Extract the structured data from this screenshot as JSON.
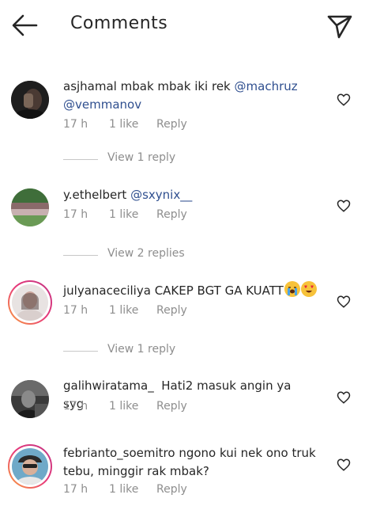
{
  "header": {
    "title": "Comments"
  },
  "comments": [
    {
      "username": "asjhamal",
      "text": "mbak mbak iki rek",
      "mentions": [
        "@machruz",
        "@vemmanov"
      ],
      "time": "17 h",
      "likes": "1 like",
      "reply": "Reply",
      "view_replies": "View 1 reply"
    },
    {
      "username": "y.ethelbert",
      "text": "",
      "mentions": [
        "@sxynix__"
      ],
      "time": "17 h",
      "likes": "1 like",
      "reply": "Reply",
      "view_replies": "View 2 replies"
    },
    {
      "username": "julyanaceciliya",
      "text": "CAKEP BGT GA KUATT",
      "emojis": [
        "loudly-crying-face",
        "heart-eyes-face"
      ],
      "time": "17 h",
      "likes": "1 like",
      "reply": "Reply",
      "view_replies": "View 1 reply"
    },
    {
      "username": "galihwiratama_",
      "text": "Hati2 masuk angin ya syg",
      "time": "17 h",
      "likes": "1 like",
      "reply": "Reply"
    },
    {
      "username": "febrianto_soemitro",
      "text": "ngono kui nek ono truk tebu, minggir rak mbak?",
      "time": "17 h",
      "likes": "1 like",
      "reply": "Reply"
    }
  ],
  "colors": {
    "text": "#262626",
    "muted": "#8e8e8e",
    "mention": "#2f4f8f",
    "story_ring": "#e83a7a"
  }
}
